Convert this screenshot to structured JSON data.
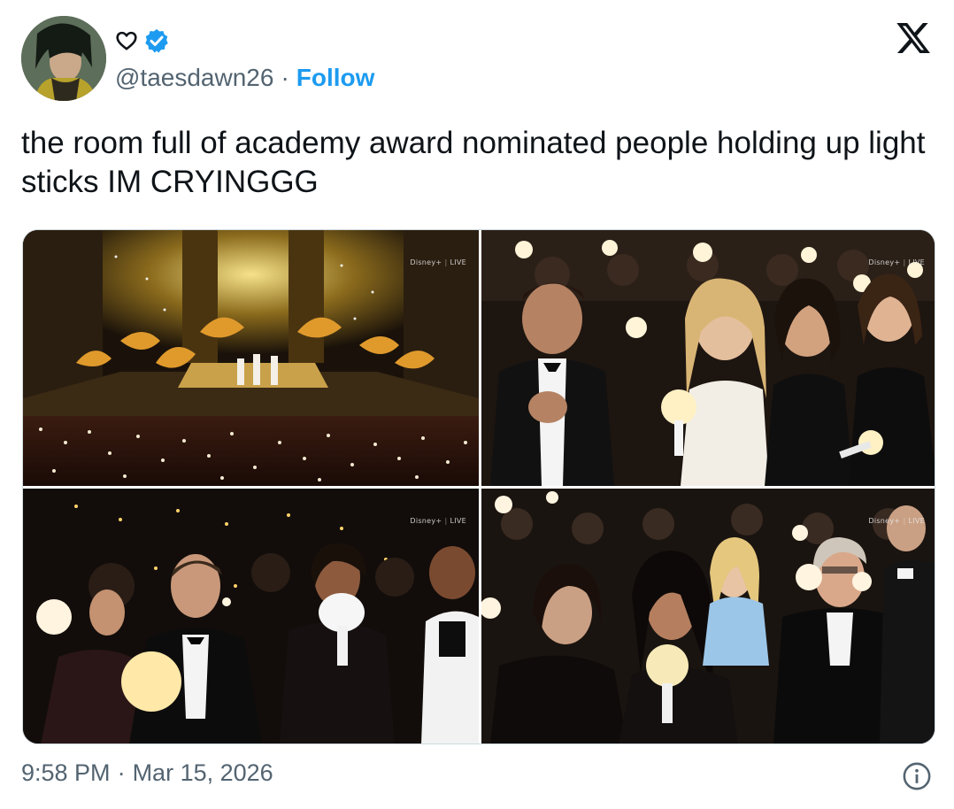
{
  "author": {
    "handle": "@taesdawn26",
    "follow_label": "Follow",
    "separator": "·",
    "verified": true
  },
  "tweet": {
    "text": "the room full of academy award nominated people holding up light sticks IM CRYINGGG"
  },
  "media": {
    "count": 4,
    "broadcast_badge": "Disney+",
    "broadcast_live": "LIVE"
  },
  "footer": {
    "time": "9:58 PM",
    "separator": "·",
    "date": "Mar 15, 2026"
  },
  "icons": {
    "heart": "heart-outline-icon",
    "verified": "verified-badge-icon",
    "brand": "x-logo-icon",
    "info": "info-icon"
  },
  "colors": {
    "accent": "#1d9bf0",
    "muted": "#536471",
    "text": "#0f1419"
  }
}
